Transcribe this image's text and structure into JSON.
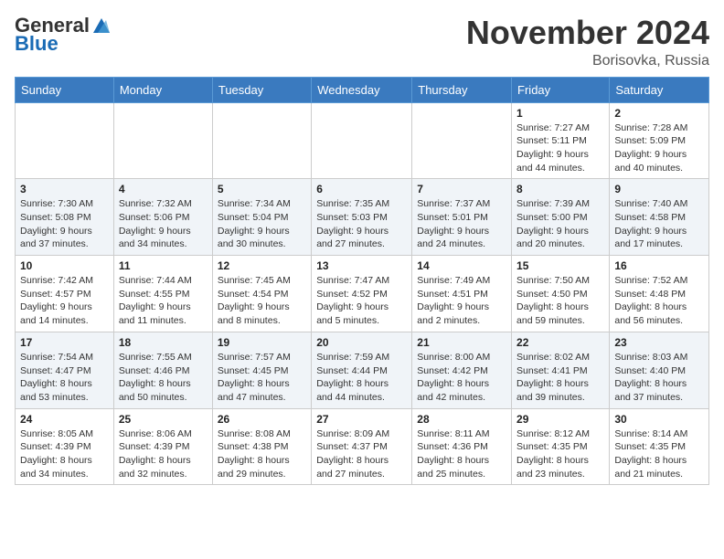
{
  "header": {
    "logo_general": "General",
    "logo_blue": "Blue",
    "month_title": "November 2024",
    "location": "Borisovka, Russia"
  },
  "days_of_week": [
    "Sunday",
    "Monday",
    "Tuesday",
    "Wednesday",
    "Thursday",
    "Friday",
    "Saturday"
  ],
  "weeks": [
    [
      {
        "day": "",
        "info": ""
      },
      {
        "day": "",
        "info": ""
      },
      {
        "day": "",
        "info": ""
      },
      {
        "day": "",
        "info": ""
      },
      {
        "day": "",
        "info": ""
      },
      {
        "day": "1",
        "info": "Sunrise: 7:27 AM\nSunset: 5:11 PM\nDaylight: 9 hours\nand 44 minutes."
      },
      {
        "day": "2",
        "info": "Sunrise: 7:28 AM\nSunset: 5:09 PM\nDaylight: 9 hours\nand 40 minutes."
      }
    ],
    [
      {
        "day": "3",
        "info": "Sunrise: 7:30 AM\nSunset: 5:08 PM\nDaylight: 9 hours\nand 37 minutes."
      },
      {
        "day": "4",
        "info": "Sunrise: 7:32 AM\nSunset: 5:06 PM\nDaylight: 9 hours\nand 34 minutes."
      },
      {
        "day": "5",
        "info": "Sunrise: 7:34 AM\nSunset: 5:04 PM\nDaylight: 9 hours\nand 30 minutes."
      },
      {
        "day": "6",
        "info": "Sunrise: 7:35 AM\nSunset: 5:03 PM\nDaylight: 9 hours\nand 27 minutes."
      },
      {
        "day": "7",
        "info": "Sunrise: 7:37 AM\nSunset: 5:01 PM\nDaylight: 9 hours\nand 24 minutes."
      },
      {
        "day": "8",
        "info": "Sunrise: 7:39 AM\nSunset: 5:00 PM\nDaylight: 9 hours\nand 20 minutes."
      },
      {
        "day": "9",
        "info": "Sunrise: 7:40 AM\nSunset: 4:58 PM\nDaylight: 9 hours\nand 17 minutes."
      }
    ],
    [
      {
        "day": "10",
        "info": "Sunrise: 7:42 AM\nSunset: 4:57 PM\nDaylight: 9 hours\nand 14 minutes."
      },
      {
        "day": "11",
        "info": "Sunrise: 7:44 AM\nSunset: 4:55 PM\nDaylight: 9 hours\nand 11 minutes."
      },
      {
        "day": "12",
        "info": "Sunrise: 7:45 AM\nSunset: 4:54 PM\nDaylight: 9 hours\nand 8 minutes."
      },
      {
        "day": "13",
        "info": "Sunrise: 7:47 AM\nSunset: 4:52 PM\nDaylight: 9 hours\nand 5 minutes."
      },
      {
        "day": "14",
        "info": "Sunrise: 7:49 AM\nSunset: 4:51 PM\nDaylight: 9 hours\nand 2 minutes."
      },
      {
        "day": "15",
        "info": "Sunrise: 7:50 AM\nSunset: 4:50 PM\nDaylight: 8 hours\nand 59 minutes."
      },
      {
        "day": "16",
        "info": "Sunrise: 7:52 AM\nSunset: 4:48 PM\nDaylight: 8 hours\nand 56 minutes."
      }
    ],
    [
      {
        "day": "17",
        "info": "Sunrise: 7:54 AM\nSunset: 4:47 PM\nDaylight: 8 hours\nand 53 minutes."
      },
      {
        "day": "18",
        "info": "Sunrise: 7:55 AM\nSunset: 4:46 PM\nDaylight: 8 hours\nand 50 minutes."
      },
      {
        "day": "19",
        "info": "Sunrise: 7:57 AM\nSunset: 4:45 PM\nDaylight: 8 hours\nand 47 minutes."
      },
      {
        "day": "20",
        "info": "Sunrise: 7:59 AM\nSunset: 4:44 PM\nDaylight: 8 hours\nand 44 minutes."
      },
      {
        "day": "21",
        "info": "Sunrise: 8:00 AM\nSunset: 4:42 PM\nDaylight: 8 hours\nand 42 minutes."
      },
      {
        "day": "22",
        "info": "Sunrise: 8:02 AM\nSunset: 4:41 PM\nDaylight: 8 hours\nand 39 minutes."
      },
      {
        "day": "23",
        "info": "Sunrise: 8:03 AM\nSunset: 4:40 PM\nDaylight: 8 hours\nand 37 minutes."
      }
    ],
    [
      {
        "day": "24",
        "info": "Sunrise: 8:05 AM\nSunset: 4:39 PM\nDaylight: 8 hours\nand 34 minutes."
      },
      {
        "day": "25",
        "info": "Sunrise: 8:06 AM\nSunset: 4:39 PM\nDaylight: 8 hours\nand 32 minutes."
      },
      {
        "day": "26",
        "info": "Sunrise: 8:08 AM\nSunset: 4:38 PM\nDaylight: 8 hours\nand 29 minutes."
      },
      {
        "day": "27",
        "info": "Sunrise: 8:09 AM\nSunset: 4:37 PM\nDaylight: 8 hours\nand 27 minutes."
      },
      {
        "day": "28",
        "info": "Sunrise: 8:11 AM\nSunset: 4:36 PM\nDaylight: 8 hours\nand 25 minutes."
      },
      {
        "day": "29",
        "info": "Sunrise: 8:12 AM\nSunset: 4:35 PM\nDaylight: 8 hours\nand 23 minutes."
      },
      {
        "day": "30",
        "info": "Sunrise: 8:14 AM\nSunset: 4:35 PM\nDaylight: 8 hours\nand 21 minutes."
      }
    ]
  ]
}
